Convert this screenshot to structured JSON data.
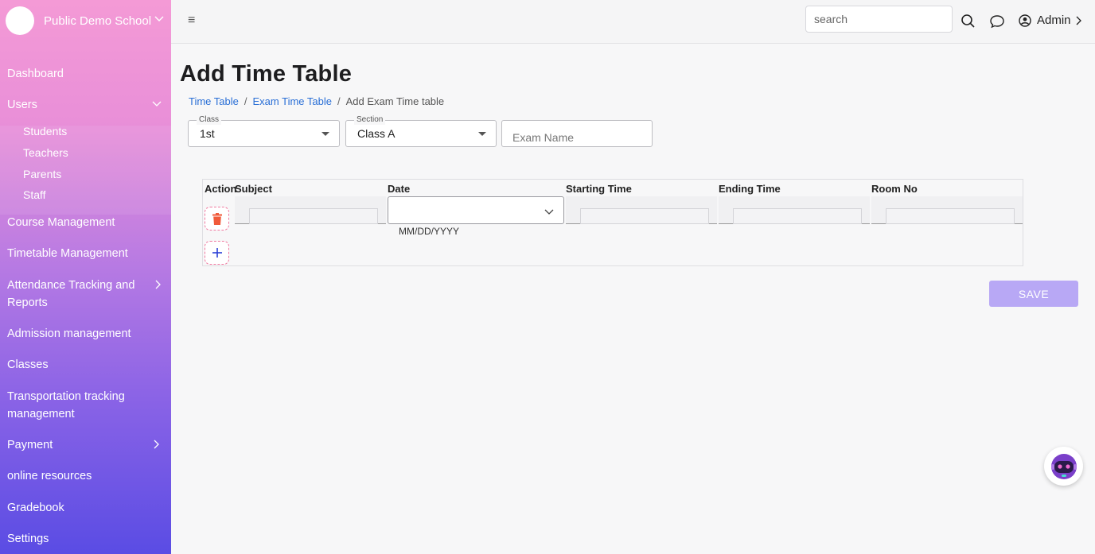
{
  "sidebar": {
    "school_name": "Public Demo School",
    "items": [
      {
        "label": "Dashboard"
      },
      {
        "label": "Users"
      },
      {
        "label": "Course Management"
      },
      {
        "label": "Timetable Management"
      },
      {
        "label": "Attendance Tracking and Reports"
      },
      {
        "label": "Admission management"
      },
      {
        "label": "Classes"
      },
      {
        "label": "Transportation tracking management"
      },
      {
        "label": "Payment"
      },
      {
        "label": "online resources"
      },
      {
        "label": "Gradebook"
      },
      {
        "label": "Settings"
      }
    ],
    "sub_items": [
      {
        "label": "Students"
      },
      {
        "label": "Teachers"
      },
      {
        "label": "Parents"
      },
      {
        "label": "Staff"
      }
    ]
  },
  "topbar": {
    "search_placeholder": "search",
    "user_label": "Admin"
  },
  "main": {
    "title": "Add Time Table",
    "breadcrumb": {
      "crumb1": "Time Table",
      "sep": "/",
      "crumb2": "Exam Time Table",
      "current": "Add Exam Time table"
    },
    "filters": {
      "class_label": "Class",
      "class_value": "1st",
      "section_label": "Section",
      "section_value": "Class A",
      "exam_name_placeholder": "Exam Name"
    },
    "table": {
      "headers": [
        "Action",
        "Subject",
        "Date",
        "Starting Time",
        "Ending Time",
        "Room No"
      ],
      "date_hint": "MM/DD/YYYY"
    },
    "save_label": "SAVE"
  },
  "colors": {
    "accent": "#2a6fd6",
    "save_button": "#b8a8f5",
    "delete_icon": "#f05a3a",
    "add_icon": "#2a3fd6"
  }
}
